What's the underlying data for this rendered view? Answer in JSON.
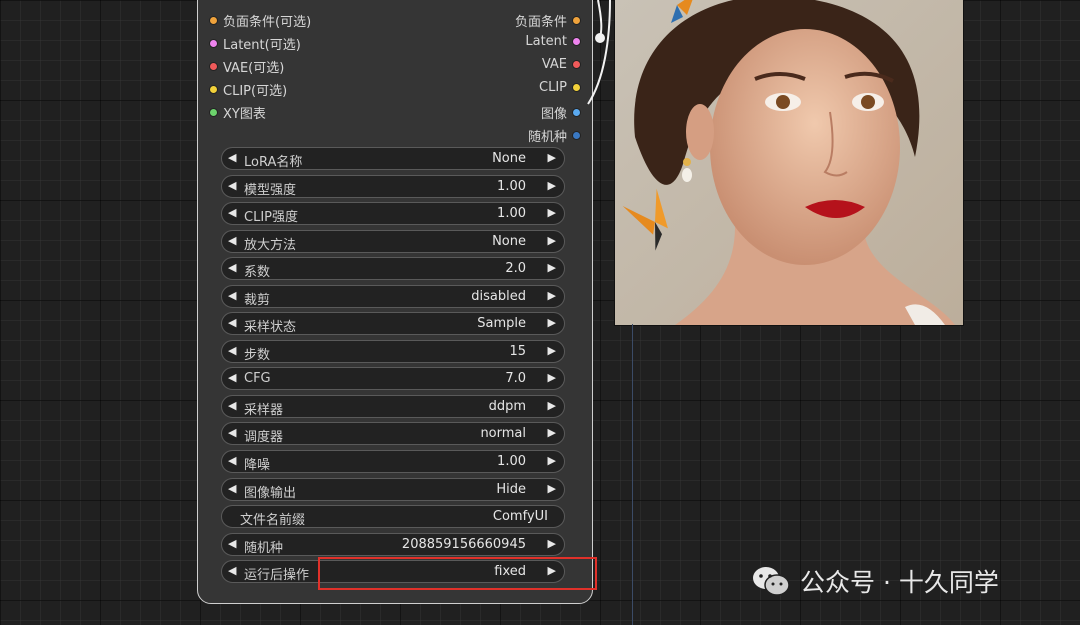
{
  "node": {
    "io_rows": [
      {
        "left_label": "负面条件(可选)",
        "left_color": "#f0a33c",
        "right_label": "负面条件",
        "right_color": "#f0a33c"
      },
      {
        "left_label": "Latent(可选)",
        "left_color": "#ee84ee",
        "right_label": "Latent",
        "right_color": "#ee84ee"
      },
      {
        "left_label": "VAE(可选)",
        "left_color": "#f05a5a",
        "right_label": "VAE",
        "right_color": "#f05a5a"
      },
      {
        "left_label": "CLIP(可选)",
        "left_color": "#f2d13a",
        "right_label": "CLIP",
        "right_color": "#f2d13a"
      },
      {
        "left_label": "XY图表",
        "left_color": "#6cd36c",
        "right_label": "图像",
        "right_color": "#5aa9f0"
      },
      {
        "left_label": "",
        "left_color": "",
        "right_label": "随机种",
        "right_color": "#3a78c2"
      }
    ],
    "widgets": [
      {
        "label": "LoRA名称",
        "value": "None"
      },
      {
        "label": "模型强度",
        "value": "1.00"
      },
      {
        "label": "CLIP强度",
        "value": "1.00"
      },
      {
        "label": "放大方法",
        "value": "None"
      },
      {
        "label": "系数",
        "value": "2.0"
      },
      {
        "label": "裁剪",
        "value": "disabled"
      },
      {
        "label": "采样状态",
        "value": "Sample"
      },
      {
        "label": "步数",
        "value": "15"
      },
      {
        "label": "CFG",
        "value": "7.0"
      },
      {
        "label": "采样器",
        "value": "ddpm"
      },
      {
        "label": "调度器",
        "value": "normal"
      },
      {
        "label": "降噪",
        "value": "1.00"
      },
      {
        "label": "图像输出",
        "value": "Hide"
      }
    ],
    "text_widget": {
      "label": "文件名前缀",
      "value": "ComfyUI"
    },
    "seed_widget": {
      "label": "随机种",
      "value": "208859156660945"
    },
    "after_run_widget": {
      "label": "运行后操作",
      "value": "fixed"
    }
  },
  "icons": {
    "left_arrow": "◀",
    "right_arrow": "▶"
  },
  "watermark": {
    "text": "公众号 · 十久同学",
    "icon": "wechat-icon"
  },
  "colors": {
    "highlight": "#e0312a",
    "node_bg": "#353535",
    "canvas_bg": "#202020"
  }
}
